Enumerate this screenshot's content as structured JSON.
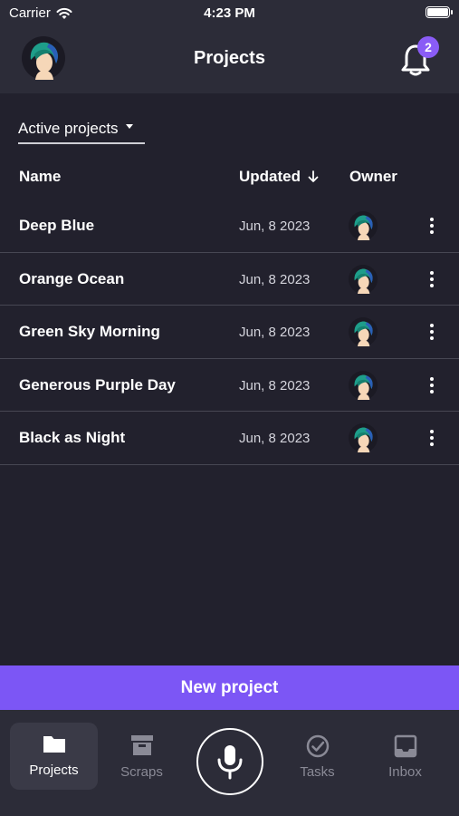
{
  "status_bar": {
    "carrier": "Carrier",
    "time": "4:23 PM"
  },
  "header": {
    "title": "Projects",
    "notification_count": "2"
  },
  "filter": {
    "label": "Active projects"
  },
  "table": {
    "columns": {
      "name": "Name",
      "updated": "Updated",
      "owner": "Owner"
    },
    "rows": [
      {
        "name": "Deep Blue",
        "updated": "Jun, 8 2023"
      },
      {
        "name": "Orange Ocean",
        "updated": "Jun, 8 2023"
      },
      {
        "name": "Green Sky Morning",
        "updated": "Jun, 8 2023"
      },
      {
        "name": "Generous Purple Day",
        "updated": "Jun, 8 2023"
      },
      {
        "name": "Black as Night",
        "updated": "Jun, 8 2023"
      }
    ]
  },
  "new_project_label": "New project",
  "tabs": [
    {
      "label": "Projects",
      "icon": "folder-icon",
      "active": true
    },
    {
      "label": "Scraps",
      "icon": "archive-icon",
      "active": false
    },
    {
      "label": "Tasks",
      "icon": "check-circle-icon",
      "active": false
    },
    {
      "label": "Inbox",
      "icon": "inbox-icon",
      "active": false
    }
  ],
  "colors": {
    "background": "#22212d",
    "bar": "#2c2c38",
    "accent": "#7c56f5",
    "badge": "#8a5cf6"
  }
}
